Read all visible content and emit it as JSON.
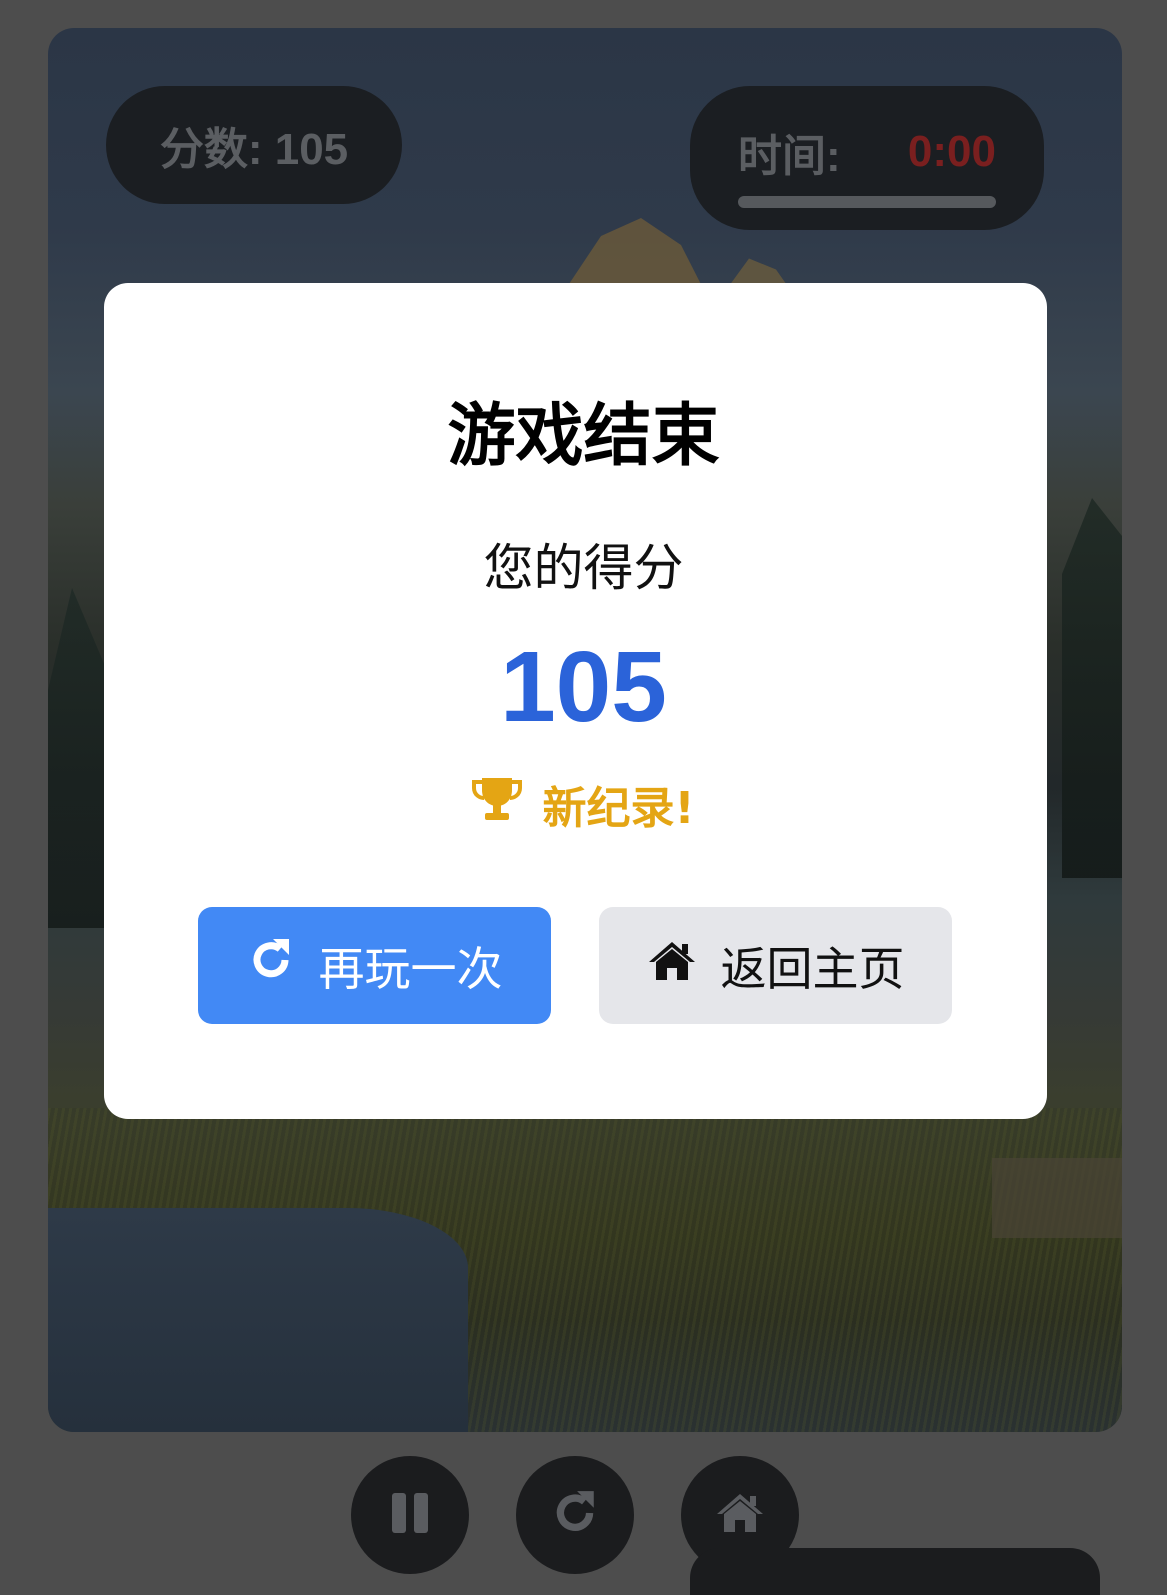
{
  "hud": {
    "score_text": "分数: 105",
    "time_label": "时间:",
    "time_value": "0:00",
    "time_progress": 0
  },
  "modal": {
    "title": "游戏结束",
    "subtitle": "您的得分",
    "score": "105",
    "record_text": "新纪录!",
    "play_again_label": "再玩一次",
    "home_label": "返回主页"
  },
  "controls": {
    "pause_icon": "pause-icon",
    "restart_icon": "restart-icon",
    "home_icon": "home-icon"
  },
  "colors": {
    "accent": "#4289f5",
    "score": "#2b63d9",
    "record": "#e4a514",
    "time_value": "#7a1f1f"
  }
}
